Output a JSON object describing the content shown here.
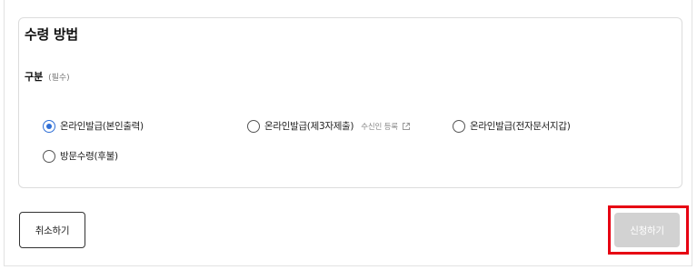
{
  "section": {
    "title": "수령 방법"
  },
  "field": {
    "label": "구분",
    "required_note": "(필수)"
  },
  "options": [
    {
      "label": "온라인발급(본인출력)",
      "checked": true
    },
    {
      "label": "온라인발급(제3자제출)",
      "checked": false,
      "sub_label": "수신인 등록",
      "sub_icon": "external-link-icon"
    },
    {
      "label": "온라인발급(전자문서지갑)",
      "checked": false
    },
    {
      "label": "방문수령(후불)",
      "checked": false
    }
  ],
  "actions": {
    "cancel_label": "취소하기",
    "apply_label": "신청하기"
  },
  "colors": {
    "accent": "#2f6fd6",
    "apply_button_bg": "#d2d2d2",
    "highlight_border": "#e60012"
  }
}
